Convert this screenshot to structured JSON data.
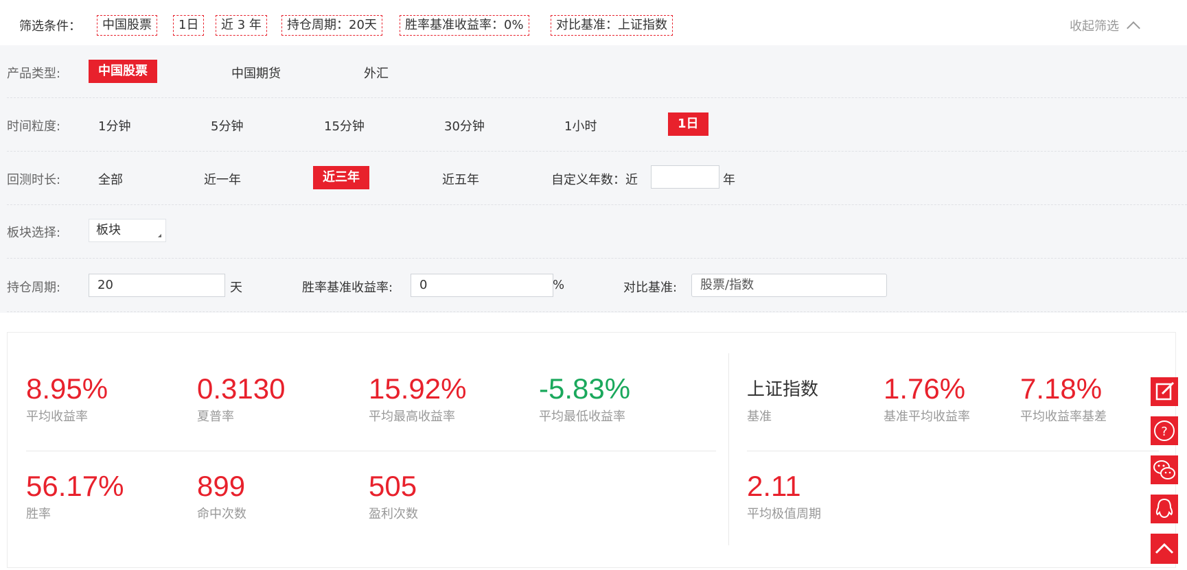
{
  "summary": {
    "label": "筛选条件：",
    "chips": [
      "中国股票",
      "1日",
      "近 3 年",
      "持仓周期：20天",
      "胜率基准收益率：0%",
      "对比基准：上证指数"
    ],
    "collapse_label": "收起筛选"
  },
  "filters": {
    "product": {
      "label": "产品类型:",
      "options": [
        "中国股票",
        "中国期货",
        "外汇"
      ],
      "selected": "中国股票"
    },
    "granularity": {
      "label": "时间粒度:",
      "options": [
        "1分钟",
        "5分钟",
        "15分钟",
        "30分钟",
        "1小时",
        "1日"
      ],
      "selected": "1日"
    },
    "backtest": {
      "label": "回测时长:",
      "options": [
        "全部",
        "近一年",
        "近三年",
        "近五年"
      ],
      "selected": "近三年",
      "custom_label": "自定义年数：近",
      "custom_value": "",
      "custom_unit": "年"
    },
    "sector": {
      "label": "板块选择:",
      "value": "板块"
    },
    "holding": {
      "label": "持仓周期:",
      "value": "20",
      "unit": "天",
      "winrate_label": "胜率基准收益率:",
      "winrate_value": "0",
      "winrate_unit": "%",
      "benchmark_label": "对比基准:",
      "benchmark_placeholder": "股票/指数"
    }
  },
  "stats": {
    "left": [
      {
        "value": "8.95%",
        "label": "平均收益率"
      },
      {
        "value": "0.3130",
        "label": "夏普率"
      },
      {
        "value": "15.92%",
        "label": "平均最高收益率"
      },
      {
        "value": "-5.83%",
        "label": "平均最低收益率"
      },
      {
        "value": "56.17%",
        "label": "胜率"
      },
      {
        "value": "899",
        "label": "命中次数"
      },
      {
        "value": "505",
        "label": "盈利次数"
      }
    ],
    "right": [
      {
        "value": "上证指数",
        "label": "基准"
      },
      {
        "value": "1.76%",
        "label": "基准平均收益率"
      },
      {
        "value": "7.18%",
        "label": "平均收益率基差"
      },
      {
        "value": "2.11",
        "label": "平均极值周期"
      }
    ]
  },
  "colors": {
    "accent": "#e8212c",
    "positive": "#1aa85c",
    "panel_bg": "#f5f6f8"
  },
  "float_buttons": [
    "edit-icon",
    "help-icon",
    "wechat-icon",
    "qq-icon",
    "back-to-top-icon"
  ]
}
